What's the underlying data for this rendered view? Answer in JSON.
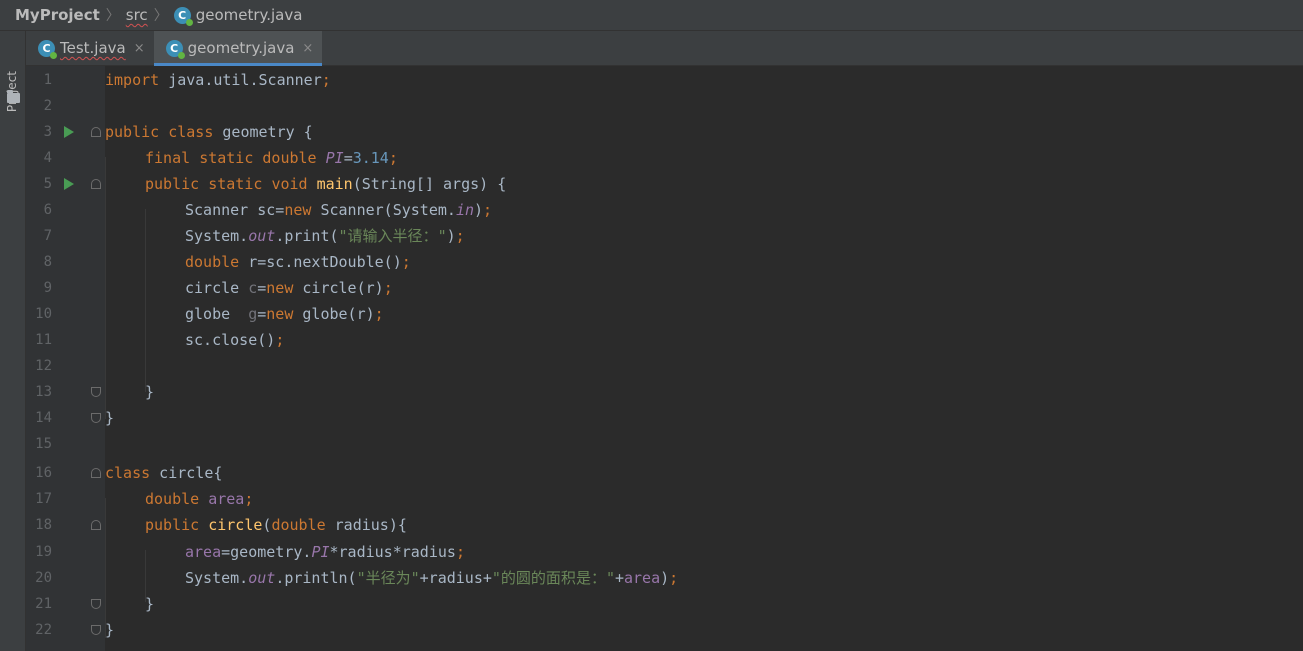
{
  "breadcrumb": {
    "project": "MyProject",
    "folder": "src",
    "file": "geometry.java",
    "class_icon_letter": "C"
  },
  "sidebar": {
    "label": "Project"
  },
  "tabs": [
    {
      "label": "Test.java",
      "close": "×"
    },
    {
      "label": "geometry.java",
      "close": "×"
    }
  ],
  "colors": {
    "keyword": "#cc7832",
    "field": "#9876aa",
    "number": "#6897bb",
    "string": "#6a8759",
    "method": "#ffc66d",
    "default": "#a9b7c6",
    "accent": "#4a88c7"
  },
  "editor": {
    "line_numbers": [
      "1",
      "2",
      "3",
      "4",
      "5",
      "6",
      "7",
      "8",
      "9",
      "10",
      "11",
      "12",
      "13",
      "14",
      "15",
      "16",
      "17",
      "18",
      "19",
      "20",
      "21",
      "22"
    ],
    "tokens": {
      "l1_import": "import",
      "l1_rest": " java.util.Scanner",
      "l1_semi": ";",
      "l3_public": "public",
      "l3_class": "class",
      "l3_rest": " geometry {",
      "l4_final": "final",
      "l4_static": "static",
      "l4_double": "double",
      "l4_pi": "PI",
      "l4_eq": "=",
      "l4_num": "3.14",
      "l4_semi": ";",
      "l5_public": "public",
      "l5_static": "static",
      "l5_void": "void",
      "l5_main": "main",
      "l5_rest": "(String[] args) {",
      "l6_a": "Scanner sc=",
      "l6_new": "new",
      "l6_b": " Scanner(System.",
      "l6_in": "in",
      "l6_c": ")",
      "l6_semi": ";",
      "l7_a": "System.",
      "l7_out": "out",
      "l7_b": ".print(",
      "l7_str": "\"请输入半径：\"",
      "l7_c": ")",
      "l7_semi": ";",
      "l8_double": "double",
      "l8_rest": " r=sc.nextDouble()",
      "l8_semi": ";",
      "l9_a": "circle ",
      "l9_var": "c",
      "l9_eq": "=",
      "l9_new": "new",
      "l9_b": " circle(r)",
      "l9_semi": ";",
      "l10_a": "globe  ",
      "l10_var": "g",
      "l10_eq": "=",
      "l10_new": "new",
      "l10_b": " globe(r)",
      "l10_semi": ";",
      "l11_a": "sc.close()",
      "l11_semi": ";",
      "l13_brace": "}",
      "l14_brace": "}",
      "l16_class": "class",
      "l16_rest": " circle{",
      "l17_double": "double",
      "l17_area": "area",
      "l17_semi": ";",
      "l18_public": "public",
      "l18_circle": "circle",
      "l18_a": "(",
      "l18_double": "double",
      "l18_b": " radius){",
      "l19_area": "area",
      "l19_a": "=geometry.",
      "l19_pi": "PI",
      "l19_b": "*radius*radius",
      "l19_semi": ";",
      "l20_a": "System.",
      "l20_out": "out",
      "l20_b": ".println(",
      "l20_str1": "\"半径为\"",
      "l20_c": "+radius+",
      "l20_str2": "\"的圆的面积是：\"",
      "l20_d": "+",
      "l20_area": "area",
      "l20_e": ")",
      "l20_semi": ";",
      "l21_brace": "}",
      "l22_brace": "}"
    }
  }
}
